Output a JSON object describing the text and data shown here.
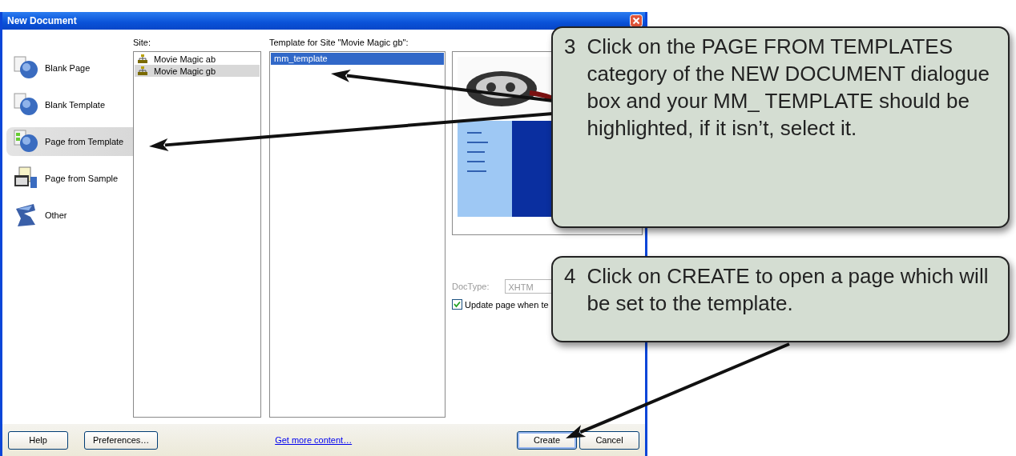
{
  "window": {
    "title": "New Document"
  },
  "categories": [
    {
      "label": "Blank Page",
      "selected": false
    },
    {
      "label": "Blank Template",
      "selected": false
    },
    {
      "label": "Page from Template",
      "selected": true
    },
    {
      "label": "Page from Sample",
      "selected": false
    },
    {
      "label": "Other",
      "selected": false
    }
  ],
  "site": {
    "label": "Site:",
    "items": [
      {
        "label": "Movie Magic ab",
        "selected": false
      },
      {
        "label": "Movie Magic gb",
        "selected": true
      }
    ]
  },
  "templates": {
    "label": "Template for Site \"Movie Magic gb\":",
    "items": [
      {
        "label": "mm_template",
        "selected": true
      }
    ]
  },
  "doctype": {
    "label": "DocType:",
    "value": "XHTM",
    "disabled": true
  },
  "update_checkbox": {
    "label": "Update page when te",
    "checked": true
  },
  "left_buttons": [
    {
      "label": "Help"
    },
    {
      "label": "Preferences…"
    }
  ],
  "link": "Get more content…",
  "right_buttons": [
    {
      "label": "Create",
      "default": true
    },
    {
      "label": "Cancel",
      "default": false
    }
  ],
  "callouts": [
    {
      "number": "3",
      "text": "Click on the PAGE FROM TEMPLATES category of the NEW DOCUMENT dialogue box and your MM_ TEMPLATE should be highlighted, if it isn’t, select it."
    },
    {
      "number": "4",
      "text": "Click on CREATE to open a page which will be set to the template."
    }
  ]
}
